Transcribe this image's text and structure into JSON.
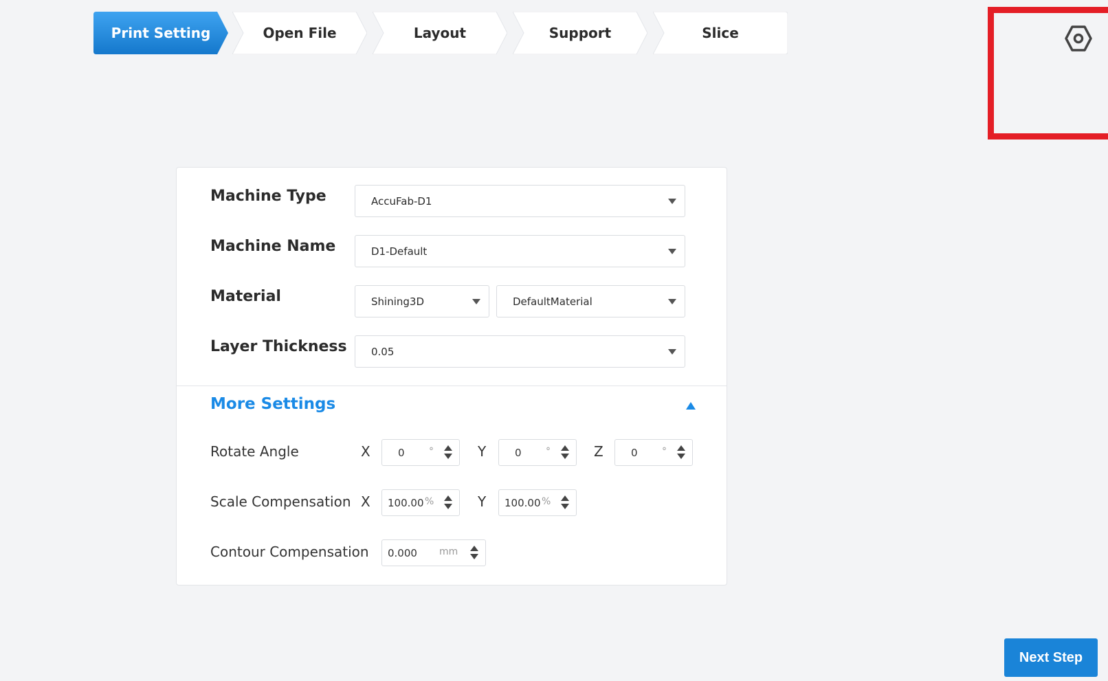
{
  "steps": [
    {
      "label": "Print Setting",
      "active": true
    },
    {
      "label": "Open File",
      "active": false
    },
    {
      "label": "Layout",
      "active": false
    },
    {
      "label": "Support",
      "active": false
    },
    {
      "label": "Slice",
      "active": false
    }
  ],
  "settings_icon": "hex-nut-settings-icon",
  "form": {
    "machine_type": {
      "label": "Machine Type",
      "value": "AccuFab-D1"
    },
    "machine_name": {
      "label": "Machine Name",
      "value": "D1-Default"
    },
    "material": {
      "label": "Material",
      "brand": "Shining3D",
      "value": "DefaultMaterial"
    },
    "layer_thickness": {
      "label": "Layer Thickness",
      "value": "0.05"
    }
  },
  "more_settings": {
    "title": "More Settings",
    "rotate_angle": {
      "label": "Rotate Angle",
      "x_label": "X",
      "x": "0",
      "y_label": "Y",
      "y": "0",
      "z_label": "Z",
      "z": "0",
      "unit": "°"
    },
    "scale_compensation": {
      "label": "Scale Compensation",
      "x_label": "X",
      "x": "100.00",
      "y_label": "Y",
      "y": "100.00",
      "unit": "%"
    },
    "contour_compensation": {
      "label": "Contour Compensation",
      "value": "0.000",
      "unit": "mm"
    }
  },
  "next_button": "Next Step",
  "colors": {
    "accent": "#1a84d8",
    "highlight": "#e41e26",
    "background": "#f3f4f6"
  }
}
